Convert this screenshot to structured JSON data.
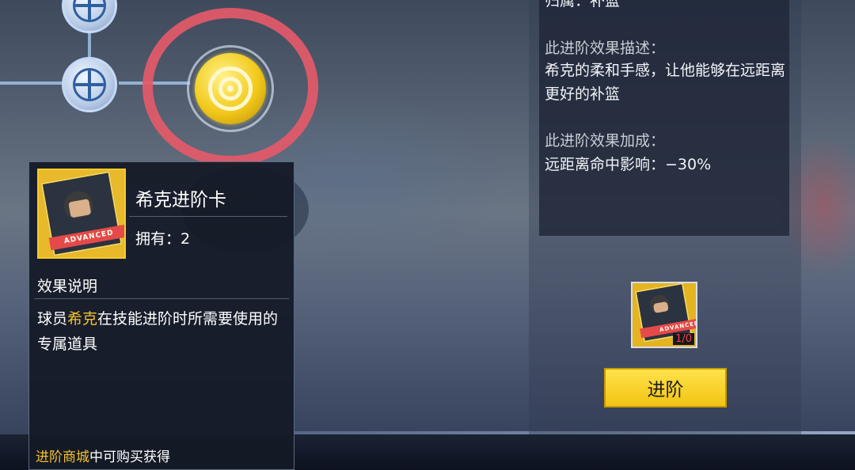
{
  "popup": {
    "card_name": "希克进阶卡",
    "own_label": "拥有：",
    "own_count": "2",
    "card_band_text": "ADVANCED",
    "section_title": "效果说明",
    "desc_pre": "球员",
    "desc_player": "希克",
    "desc_post": "在技能进阶时所需要使用的专属道具",
    "footer_highlight": "进阶商城",
    "footer_text": "中可购买获得"
  },
  "info_panel": {
    "top_line": "归属：补篮",
    "desc_label": "此进阶效果描述：",
    "desc_text": "希克的柔和手感，让他能够在远距离更好的补篮",
    "bonus_label": "此进阶效果加成：",
    "bonus_text": "远距离命中影响：−30%"
  },
  "reward": {
    "band_text": "ADVANCED",
    "quantity": "1/0"
  },
  "advance_button": {
    "label": "进阶"
  },
  "icons": {
    "skill_nodes": [
      "basketball-icon",
      "basketball-icon"
    ],
    "selected_skill": "target-icon"
  },
  "colors": {
    "highlight": "#f4c12a",
    "button": "#f2c414",
    "annotation_circle": "#e45a69"
  }
}
